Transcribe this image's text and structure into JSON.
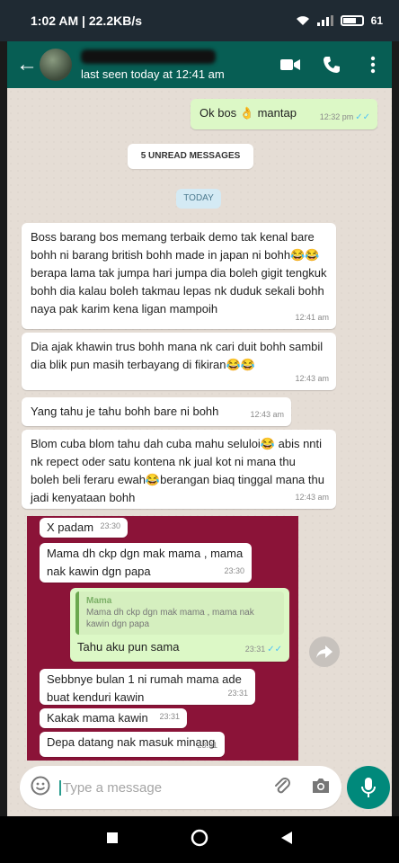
{
  "status_bar": {
    "time_speed": "1:02 AM | 22.2KB/s",
    "battery": "61"
  },
  "header": {
    "last_seen": "last seen today at 12:41 am"
  },
  "messages": {
    "m1": {
      "text": "Ok bos 👌 mantap",
      "time": "12:32 pm",
      "ticks": "✓✓"
    },
    "unread": "5 UNREAD MESSAGES",
    "today": "TODAY",
    "m2": {
      "text": "Boss barang bos memang terbaik demo tak kenal bare bohh ni barang british bohh made in japan ni bohh😂😂berapa lama tak jumpa hari jumpa dia boleh gigit tengkuk bohh dia kalau boleh takmau lepas nk duduk sekali bohh naya pak karim kena ligan mampoih",
      "time": "12:41 am"
    },
    "m3": {
      "text": "Dia ajak khawin trus bohh mana nk cari duit bohh sambil dia blik pun masih terbayang di fikiran😂😂",
      "time": "12:43 am"
    },
    "m4": {
      "text": "Yang tahu je tahu bohh bare ni bohh",
      "time": "12:43 am"
    },
    "m5": {
      "text": "Blom cuba blom tahu dah cuba mahu seluloi😂 abis nnti nk repect oder satu kontena nk jual kot ni mana thu boleh beli feraru ewah😂berangan biaq tinggal mana thu jadi kenyataan bohh",
      "time": "12:43 am"
    }
  },
  "screenshot": {
    "b1": {
      "text": "X padam",
      "time": "23:30"
    },
    "b2": {
      "text": "Mama dh ckp dgn mak mama , mama nak kawin dgn papa",
      "time": "23:30"
    },
    "quote_name": "Mama",
    "quote_text": "Mama dh ckp dgn mak mama , mama nak kawin dgn papa",
    "b3": {
      "text": "Tahu aku pun sama",
      "time": "23:31",
      "ticks": "✓✓"
    },
    "b4": {
      "text": "Sebbnye bulan 1 ni rumah mama ade buat kenduri kawin",
      "time": "23:31"
    },
    "b5": {
      "text": "Kakak mama kawin",
      "time": "23:31"
    },
    "b6": {
      "text": "Depa datang nak masuk minang",
      "time": "23:31"
    }
  },
  "input": {
    "placeholder": "Type a message"
  },
  "icons": [
    "back-arrow-icon",
    "video-call-icon",
    "phone-icon",
    "more-vert-icon",
    "emoji-icon",
    "attach-icon",
    "camera-icon",
    "mic-icon",
    "forward-icon",
    "nav-back-icon",
    "nav-home-icon",
    "nav-recents-icon"
  ]
}
